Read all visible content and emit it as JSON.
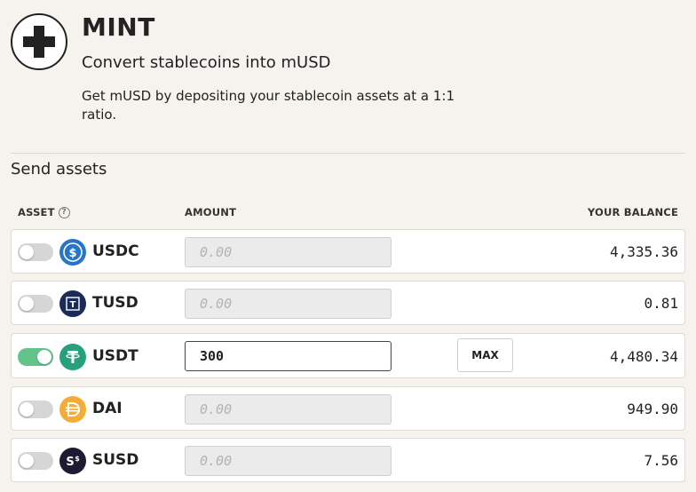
{
  "header": {
    "icon": "plus-icon",
    "title": "MINT",
    "subtitle": "Convert stablecoins into mUSD",
    "description": "Get mUSD by depositing your stablecoin assets at a 1:1 ratio."
  },
  "section": {
    "title": "Send assets"
  },
  "columns": {
    "asset": "ASSET",
    "amount": "AMOUNT",
    "balance": "YOUR BALANCE"
  },
  "rows": [
    {
      "symbol": "USDC",
      "enabled": false,
      "amount": "",
      "placeholder": "0.00",
      "balance": "4,335.36",
      "icon_color": "#2775ca"
    },
    {
      "symbol": "TUSD",
      "enabled": false,
      "amount": "",
      "placeholder": "0.00",
      "balance": "0.81",
      "icon_color": "#1a2a5a"
    },
    {
      "symbol": "USDT",
      "enabled": true,
      "amount": "300",
      "placeholder": "0.00",
      "balance": "4,480.34",
      "icon_color": "#26a17b",
      "max_label": "MAX"
    },
    {
      "symbol": "DAI",
      "enabled": false,
      "amount": "",
      "placeholder": "0.00",
      "balance": "949.90",
      "icon_color": "#f5ac37"
    },
    {
      "symbol": "SUSD",
      "enabled": false,
      "amount": "",
      "placeholder": "0.00",
      "balance": "7.56",
      "icon_color": "#1e1a31"
    }
  ],
  "colors": {
    "background": "#f6f3ef",
    "toggle_on": "#62c48b",
    "toggle_off": "#d6d6d6"
  }
}
